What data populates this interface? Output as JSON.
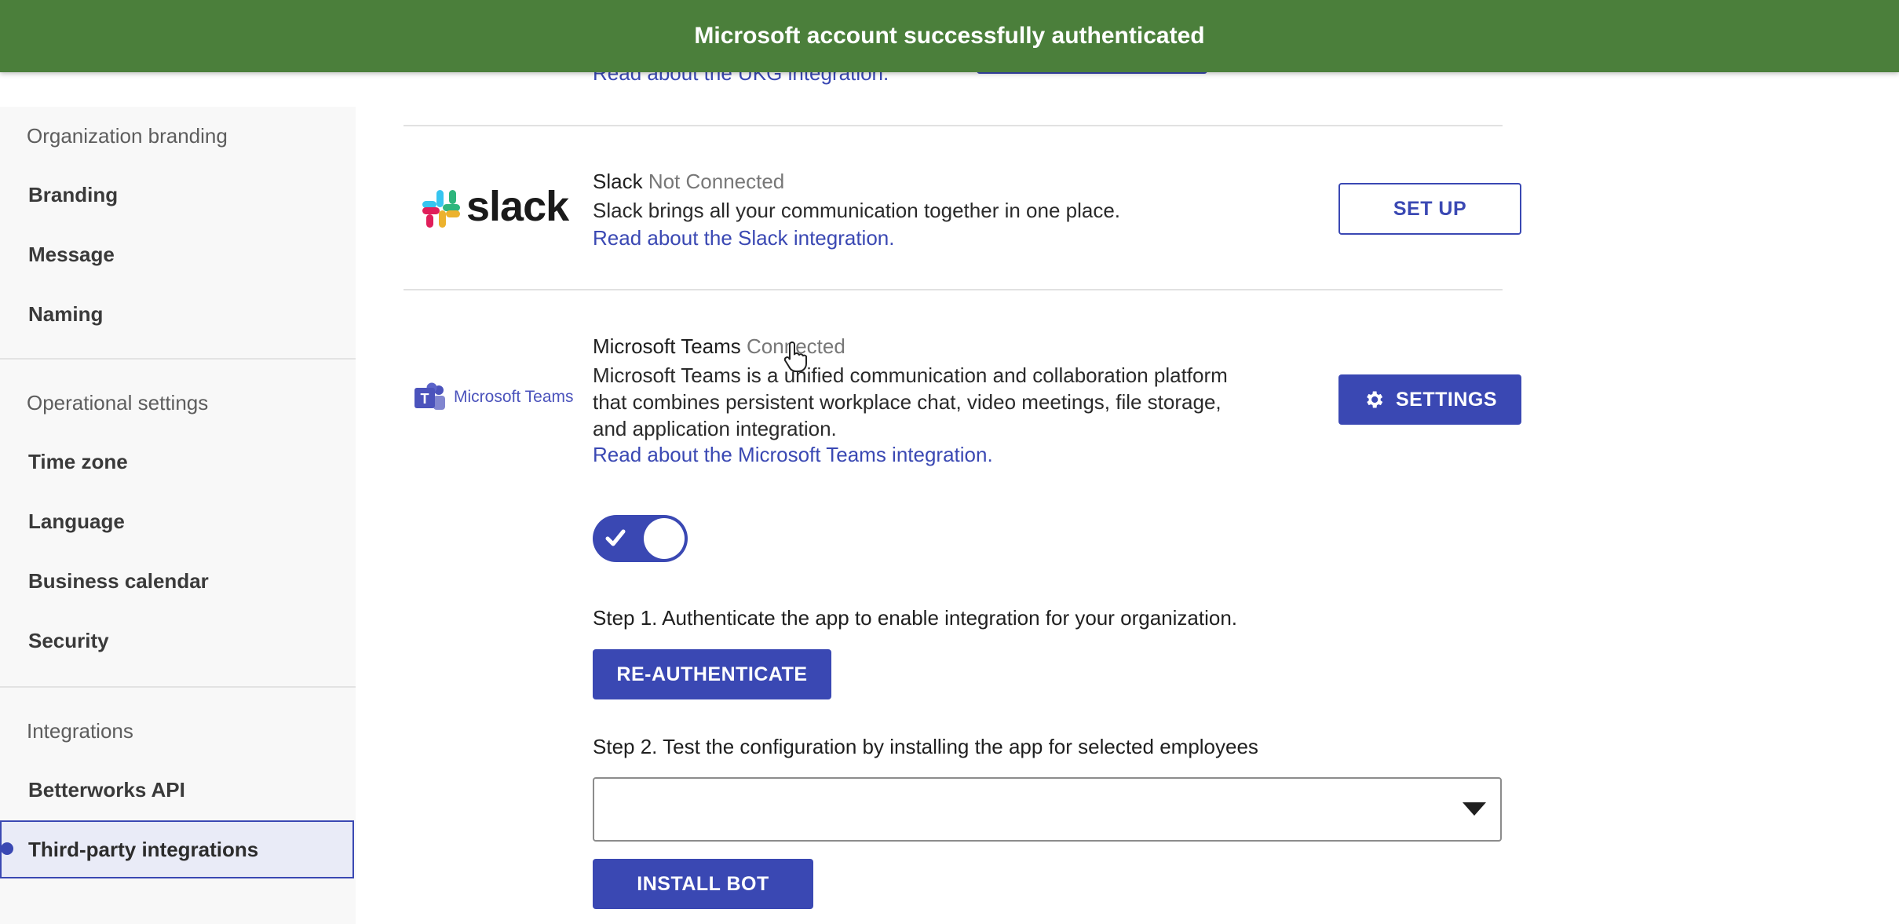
{
  "toast": {
    "message": "Microsoft account successfully authenticated",
    "color": "#4b7f3b"
  },
  "sidebar": {
    "groups": [
      {
        "label": "Organization branding",
        "items": [
          "Branding",
          "Message",
          "Naming"
        ]
      },
      {
        "label": "Operational settings",
        "items": [
          "Time zone",
          "Language",
          "Business calendar",
          "Security"
        ]
      },
      {
        "label": "Integrations",
        "items": [
          "Betterworks API",
          "Third-party integrations"
        ]
      }
    ],
    "active_item": "Third-party integrations"
  },
  "integrations": {
    "ukg": {
      "link": "Read about the UKG integration."
    },
    "slack": {
      "name": "Slack",
      "status": "Not Connected",
      "description": "Slack brings all your communication together in one place.",
      "link": "Read about the Slack integration.",
      "logo_text": "slack",
      "button": "SET UP"
    },
    "teams": {
      "name": "Microsoft Teams",
      "status": "Connected",
      "description_lines": [
        "Microsoft Teams is a unified communication and collaboration platform",
        "that combines persistent workplace chat, video meetings, file storage,",
        "and application integration."
      ],
      "link": "Read about the Microsoft Teams integration.",
      "logo_text": "Microsoft Teams",
      "button": "SETTINGS",
      "toggle_on": true,
      "step1": "Step 1. Authenticate the app to enable integration for your organization.",
      "reauth_button": "RE-AUTHENTICATE",
      "step2": "Step 2. Test the configuration by installing the app for selected employees",
      "employee_select_value": "",
      "install_button": "INSTALL BOT"
    }
  },
  "colors": {
    "accent": "#3a48b3",
    "active_bg": "#e9ebf7"
  }
}
